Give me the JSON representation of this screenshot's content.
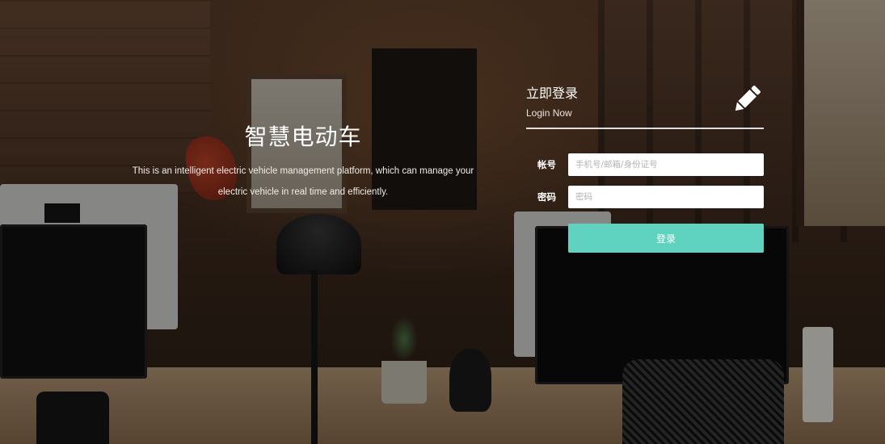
{
  "hero": {
    "title": "智慧电动车",
    "description": "This is an intelligent electric vehicle management platform, which can manage your electric vehicle in real time and efficiently."
  },
  "login": {
    "title": "立即登录",
    "subtitle": "Login Now",
    "icon": "pencil-icon",
    "account_label": "帐号",
    "account_placeholder": "手机号/邮箱/身份证号",
    "account_value": "",
    "password_label": "密码",
    "password_placeholder": "密码",
    "password_value": "",
    "submit_label": "登录"
  },
  "colors": {
    "accent": "#5fd3c0",
    "text": "#ffffff"
  }
}
